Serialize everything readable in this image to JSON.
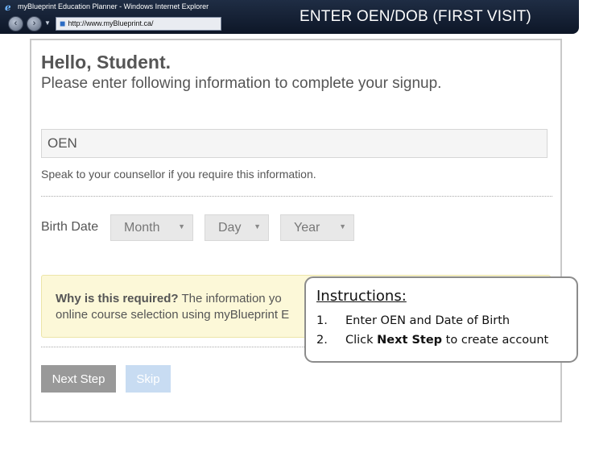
{
  "browser": {
    "window_title": "myBlueprint Education Planner - Windows Internet Explorer",
    "address": "http://www.myBlueprint.ca/"
  },
  "header": {
    "heading": "ENTER OEN/DOB (FIRST VISIT)"
  },
  "form": {
    "greeting": "Hello, Student.",
    "subheading": "Please enter following information to complete your signup.",
    "oen_placeholder": "OEN",
    "oen_value": "",
    "help_text": "Speak to your counsellor if you require this information.",
    "birth_label": "Birth Date",
    "month_label": "Month",
    "day_label": "Day",
    "year_label": "Year",
    "why_title": "Why is this required?",
    "why_text_line1": "The information yo",
    "why_text_line2": "online course selection using myBlueprint E",
    "next_label": "Next Step",
    "skip_label": "Skip"
  },
  "instructions": {
    "title": "Instructions:",
    "steps": [
      {
        "num": "1.",
        "text": "Enter OEN and Date of Birth"
      },
      {
        "num": "2.",
        "pre": "Click ",
        "bold": "Next Step",
        "post": " to create account"
      }
    ]
  },
  "colors": {
    "topbar": "#1f2d44",
    "next_button": "#999999",
    "skip_button": "#c8dcf2",
    "notice_background": "#fcf8d8"
  }
}
